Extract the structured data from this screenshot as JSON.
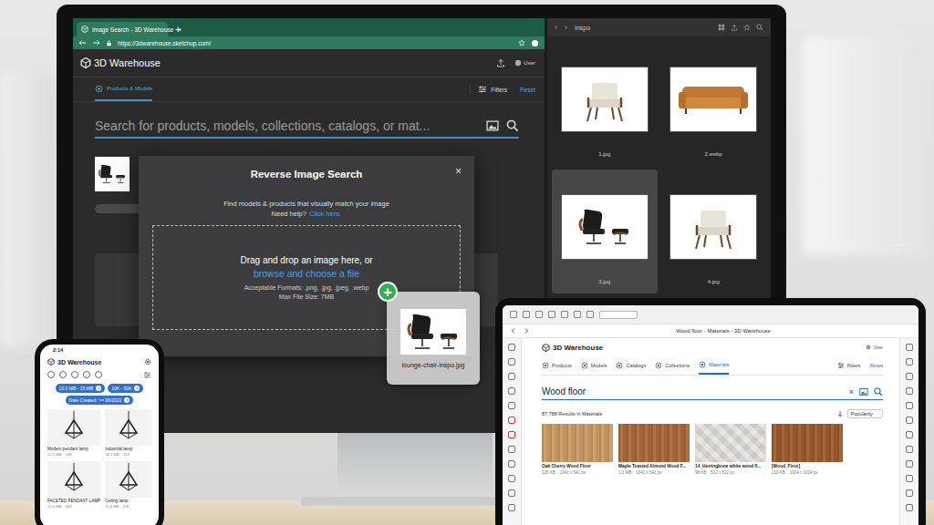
{
  "browser": {
    "tab": {
      "title": "Image Search - 3D Warehouse",
      "close": "×"
    },
    "new_tab": "+",
    "url": "https://3dwarehouse.sketchup.com/",
    "header": {
      "logo": "3D Warehouse",
      "user": "User"
    },
    "nav": {
      "tab": "Products & Models",
      "filters": "Filters",
      "reset": "Reset"
    },
    "search": {
      "placeholder": "Search for products, models, collections, catalogs, or mat..."
    },
    "modal": {
      "title": "Reverse Image Search",
      "close": "×",
      "description": "Find models & products that visually match your image",
      "help": "Need help?",
      "help_link": "Click here.",
      "drop_text": "Drag and drop an image here, or",
      "browse_link": "browse and choose a file",
      "formats": "Acceptable Formats: .png, .jpg, .jpeg, .webp",
      "max_size": "Max File Size: 7MB"
    },
    "dragged_file": {
      "badge": "+",
      "name": "lounge-chair-inspo.jpg"
    }
  },
  "finder": {
    "back": "‹",
    "forward": "›",
    "title": "Inspo",
    "files": [
      {
        "name": "1.jpg",
        "kind": "armchair",
        "selected": false
      },
      {
        "name": "2.webp",
        "kind": "sofa",
        "selected": false
      },
      {
        "name": "3.jpg",
        "kind": "lounge",
        "selected": true
      },
      {
        "name": "4.jpg",
        "kind": "armchair",
        "selected": false
      }
    ]
  },
  "tablet": {
    "window_title": "Wood floor - Materials - 3D Warehouse",
    "header": {
      "logo": "3D Warehouse",
      "user": "User"
    },
    "tabs": [
      {
        "label": "Products",
        "selected": false
      },
      {
        "label": "Models",
        "selected": false
      },
      {
        "label": "Catalogs",
        "selected": false
      },
      {
        "label": "Collections",
        "selected": false
      },
      {
        "label": "Materials",
        "selected": true
      }
    ],
    "filters": "Filters",
    "reset": "Reset",
    "search": {
      "value": "Wood floor",
      "clear": "×"
    },
    "results": "87,788 Results in Materials",
    "sort": "Popularity",
    "materials": [
      {
        "name": "Oak Cherry Wood Floor",
        "size": "125 KB",
        "dims": "1041 x 541 px",
        "color": "#c99a62"
      },
      {
        "name": "Maple Toasted Almond Wood F...",
        "size": "1.2 MB",
        "dims": "1041 x 541 px",
        "color": "#a8683a"
      },
      {
        "name": "14_Herringbone white wood fl...",
        "size": "98 KB",
        "dims": "512 x 512 px",
        "color": "#e4e1dc"
      },
      {
        "name": "[Wood_Floor]",
        "size": "210 KB",
        "dims": "1024 x 1024 px",
        "color": "#9a5a2c"
      }
    ]
  },
  "phone": {
    "time": "2:14",
    "logo": "3D Warehouse",
    "chips": [
      {
        "label": "10.0 MB - 25 MB",
        "remove": "×"
      },
      {
        "label": "10K - 50K",
        "remove": "×"
      },
      {
        "label": "Date Created: >= 06/2022",
        "remove": "×"
      }
    ],
    "products": [
      {
        "name": "Modern pendant lamp",
        "size": "12.5 MB",
        "count": "14K"
      },
      {
        "name": "Industrial lamp",
        "size": "18.1 MB",
        "count": "21K"
      },
      {
        "name": "FACETED PENDANT LAMP",
        "size": "14.6 MB",
        "count": "32K"
      },
      {
        "name": "Ceiling lamp",
        "size": "11.3 MB",
        "count": "17K"
      }
    ]
  }
}
